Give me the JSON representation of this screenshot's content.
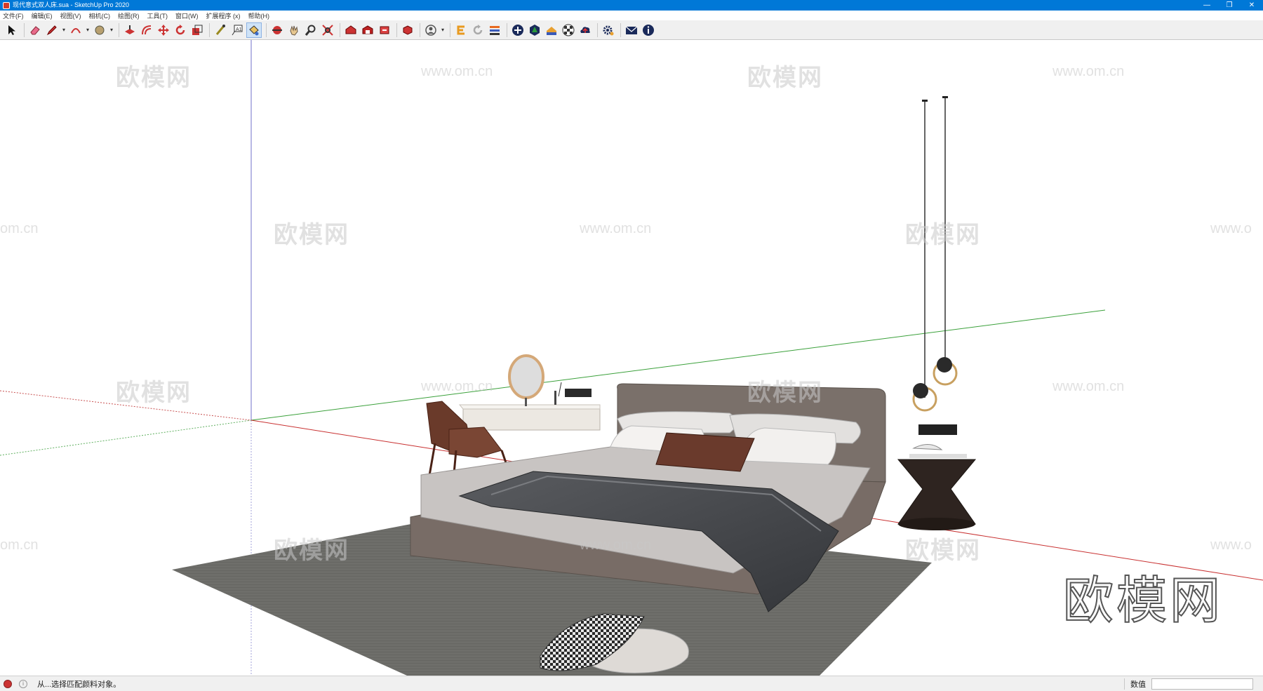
{
  "window": {
    "title": "现代意式双人床.sua - SketchUp Pro 2020",
    "buttons": {
      "minimize": "—",
      "restore": "❐",
      "close": "✕"
    }
  },
  "menu": [
    "文件(F)",
    "编辑(E)",
    "视图(V)",
    "相机(C)",
    "绘图(R)",
    "工具(T)",
    "窗口(W)",
    "扩展程序 (x)",
    "帮助(H)"
  ],
  "toolbar": {
    "tools": [
      {
        "name": "select-tool",
        "icon": "arrow-icon"
      },
      {
        "name": "eraser-tool",
        "icon": "eraser-icon"
      },
      {
        "name": "line-tool",
        "icon": "pencil-icon",
        "dropdown": true
      },
      {
        "name": "arc-tool",
        "icon": "arc-icon",
        "dropdown": true
      },
      {
        "name": "shape-tool",
        "icon": "circle-icon",
        "dropdown": true
      },
      {
        "name": "push-pull-tool",
        "icon": "pushpull-icon"
      },
      {
        "name": "offset-tool",
        "icon": "offset-icon"
      },
      {
        "name": "move-tool",
        "icon": "move-icon"
      },
      {
        "name": "rotate-tool",
        "icon": "rotate-icon"
      },
      {
        "name": "scale-tool",
        "icon": "scale-icon"
      },
      {
        "name": "tape-measure-tool",
        "icon": "tape-icon"
      },
      {
        "name": "text-tool",
        "icon": "text-icon"
      },
      {
        "name": "paint-bucket-tool",
        "icon": "bucket-icon",
        "active": true
      },
      {
        "name": "orbit-tool",
        "icon": "orbit-icon"
      },
      {
        "name": "pan-tool",
        "icon": "hand-icon"
      },
      {
        "name": "zoom-tool",
        "icon": "zoom-icon"
      },
      {
        "name": "zoom-extents-tool",
        "icon": "zoom-extents-icon"
      },
      {
        "name": "warehouse-tool",
        "icon": "warehouse-icon"
      },
      {
        "name": "extension-warehouse-tool",
        "icon": "ext-warehouse-icon"
      },
      {
        "name": "share-model-tool",
        "icon": "share-icon"
      },
      {
        "name": "trimble-connect-tool",
        "icon": "connect-icon"
      },
      {
        "name": "account-tool",
        "icon": "user-icon",
        "dropdown": true
      },
      {
        "name": "plugin-e-tool",
        "icon": "plugin-e-icon"
      },
      {
        "name": "refresh-tool",
        "icon": "refresh-icon"
      },
      {
        "name": "layers-tool",
        "icon": "layers-icon"
      },
      {
        "name": "add-tool",
        "icon": "plus-circle-icon"
      },
      {
        "name": "tree-tool",
        "icon": "tree-icon"
      },
      {
        "name": "terrain-tool",
        "icon": "terrain-icon"
      },
      {
        "name": "checker-tool",
        "icon": "checker-icon"
      },
      {
        "name": "cloud-tool",
        "icon": "cloud-icon"
      },
      {
        "name": "settings-tool",
        "icon": "gear-icon"
      },
      {
        "name": "mail-tool",
        "icon": "mail-icon"
      },
      {
        "name": "info-tool",
        "icon": "info-icon"
      }
    ]
  },
  "viewport": {
    "watermark_text": "欧模网",
    "watermark_url": "www.om.cn",
    "watermark_url_partial": "om.cn",
    "watermark_url_edge": "www.o",
    "brand_text": "欧模网"
  },
  "status": {
    "message": "从...选择匹配颜料对象。",
    "measure_label": "数值",
    "measure_value": ""
  },
  "colors": {
    "titlebar": "#0078d7",
    "axis_red": "#d04040",
    "axis_green": "#40b040",
    "axis_blue": "#4040c0"
  }
}
